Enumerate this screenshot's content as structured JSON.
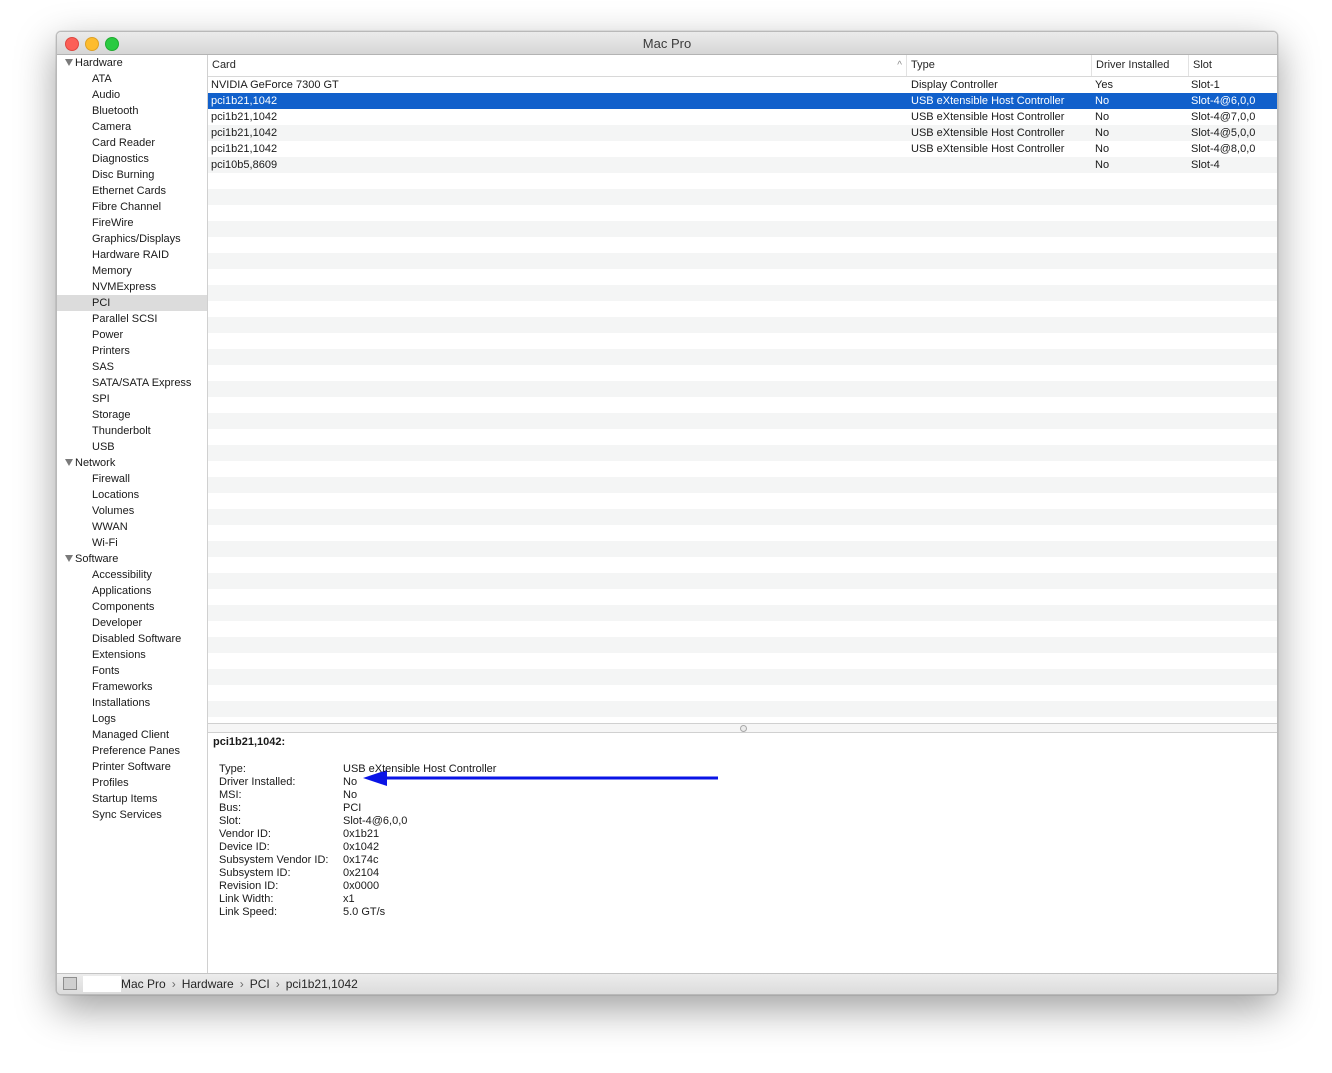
{
  "window": {
    "title": "Mac Pro"
  },
  "sidebar": {
    "items": [
      {
        "label": "Hardware",
        "type": "section"
      },
      {
        "label": "ATA",
        "type": "item"
      },
      {
        "label": "Audio",
        "type": "item"
      },
      {
        "label": "Bluetooth",
        "type": "item"
      },
      {
        "label": "Camera",
        "type": "item"
      },
      {
        "label": "Card Reader",
        "type": "item"
      },
      {
        "label": "Diagnostics",
        "type": "item"
      },
      {
        "label": "Disc Burning",
        "type": "item"
      },
      {
        "label": "Ethernet Cards",
        "type": "item"
      },
      {
        "label": "Fibre Channel",
        "type": "item"
      },
      {
        "label": "FireWire",
        "type": "item"
      },
      {
        "label": "Graphics/Displays",
        "type": "item"
      },
      {
        "label": "Hardware RAID",
        "type": "item"
      },
      {
        "label": "Memory",
        "type": "item"
      },
      {
        "label": "NVMExpress",
        "type": "item"
      },
      {
        "label": "PCI",
        "type": "item",
        "selected": true
      },
      {
        "label": "Parallel SCSI",
        "type": "item"
      },
      {
        "label": "Power",
        "type": "item"
      },
      {
        "label": "Printers",
        "type": "item"
      },
      {
        "label": "SAS",
        "type": "item"
      },
      {
        "label": "SATA/SATA Express",
        "type": "item"
      },
      {
        "label": "SPI",
        "type": "item"
      },
      {
        "label": "Storage",
        "type": "item"
      },
      {
        "label": "Thunderbolt",
        "type": "item"
      },
      {
        "label": "USB",
        "type": "item"
      },
      {
        "label": "Network",
        "type": "section"
      },
      {
        "label": "Firewall",
        "type": "item"
      },
      {
        "label": "Locations",
        "type": "item"
      },
      {
        "label": "Volumes",
        "type": "item"
      },
      {
        "label": "WWAN",
        "type": "item"
      },
      {
        "label": "Wi-Fi",
        "type": "item"
      },
      {
        "label": "Software",
        "type": "section"
      },
      {
        "label": "Accessibility",
        "type": "item"
      },
      {
        "label": "Applications",
        "type": "item"
      },
      {
        "label": "Components",
        "type": "item"
      },
      {
        "label": "Developer",
        "type": "item"
      },
      {
        "label": "Disabled Software",
        "type": "item"
      },
      {
        "label": "Extensions",
        "type": "item"
      },
      {
        "label": "Fonts",
        "type": "item"
      },
      {
        "label": "Frameworks",
        "type": "item"
      },
      {
        "label": "Installations",
        "type": "item"
      },
      {
        "label": "Logs",
        "type": "item"
      },
      {
        "label": "Managed Client",
        "type": "item"
      },
      {
        "label": "Preference Panes",
        "type": "item"
      },
      {
        "label": "Printer Software",
        "type": "item"
      },
      {
        "label": "Profiles",
        "type": "item"
      },
      {
        "label": "Startup Items",
        "type": "item"
      },
      {
        "label": "Sync Services",
        "type": "item"
      }
    ]
  },
  "table": {
    "columns": [
      "Card",
      "Type",
      "Driver Installed",
      "Slot"
    ],
    "sort_icon": "chevron-up-icon",
    "rows": [
      {
        "card": "NVIDIA GeForce 7300 GT",
        "type": "Display Controller",
        "driver": "Yes",
        "slot": "Slot-1"
      },
      {
        "card": "pci1b21,1042",
        "type": "USB eXtensible Host Controller",
        "driver": "No",
        "slot": "Slot-4@6,0,0",
        "selected": true
      },
      {
        "card": "pci1b21,1042",
        "type": "USB eXtensible Host Controller",
        "driver": "No",
        "slot": "Slot-4@7,0,0"
      },
      {
        "card": "pci1b21,1042",
        "type": "USB eXtensible Host Controller",
        "driver": "No",
        "slot": "Slot-4@5,0,0"
      },
      {
        "card": "pci1b21,1042",
        "type": "USB eXtensible Host Controller",
        "driver": "No",
        "slot": "Slot-4@8,0,0"
      },
      {
        "card": "pci10b5,8609",
        "type": "",
        "driver": "No",
        "slot": "Slot-4"
      }
    ],
    "selection_color": "#1160cb"
  },
  "detail": {
    "title": "pci1b21,1042:",
    "fields": [
      {
        "key": "Type:",
        "value": "USB eXtensible Host Controller"
      },
      {
        "key": "Driver Installed:",
        "value": "No"
      },
      {
        "key": "MSI:",
        "value": "No"
      },
      {
        "key": "Bus:",
        "value": "PCI"
      },
      {
        "key": "Slot:",
        "value": "Slot-4@6,0,0"
      },
      {
        "key": "Vendor ID:",
        "value": "0x1b21"
      },
      {
        "key": "Device ID:",
        "value": "0x1042"
      },
      {
        "key": "Subsystem Vendor ID:",
        "value": "0x174c"
      },
      {
        "key": "Subsystem ID:",
        "value": "0x2104"
      },
      {
        "key": "Revision ID:",
        "value": "0x0000"
      },
      {
        "key": "Link Width:",
        "value": "x1"
      },
      {
        "key": "Link Speed:",
        "value": "5.0 GT/s"
      }
    ],
    "annotation_color": "#0a14e6"
  },
  "statusbar": {
    "breadcrumb": [
      "Mac Pro",
      "Hardware",
      "PCI",
      "pci1b21,1042"
    ],
    "separator": "›"
  }
}
